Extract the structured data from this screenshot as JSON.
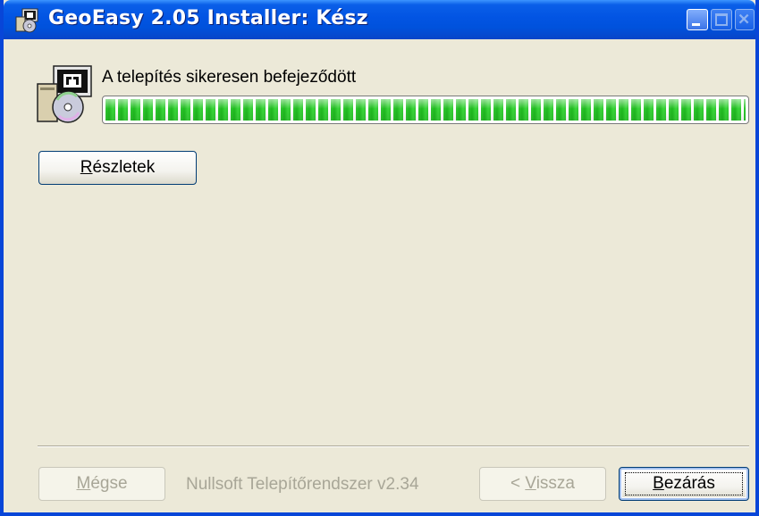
{
  "window": {
    "title": "GeoEasy 2.05 Installer: Kész"
  },
  "status": {
    "message": "A telepítés sikeresen befejeződött",
    "progress_fraction": 1.0
  },
  "buttons": {
    "details": {
      "prefix": "",
      "accel": "R",
      "rest": "észletek"
    },
    "cancel": {
      "prefix": "",
      "accel": "M",
      "rest": "égse"
    },
    "back": {
      "prefix": "< ",
      "accel": "V",
      "rest": "issza"
    },
    "close": {
      "prefix": "",
      "accel": "B",
      "rest": "ezárás"
    }
  },
  "branding": {
    "text": "Nullsoft Telepítőrendszer v2.34"
  },
  "colors": {
    "titlebar": "#0254e3",
    "dialog_bg": "#ece9d8",
    "progress_green": "#2fc82f",
    "disabled_text": "#a8a697"
  }
}
